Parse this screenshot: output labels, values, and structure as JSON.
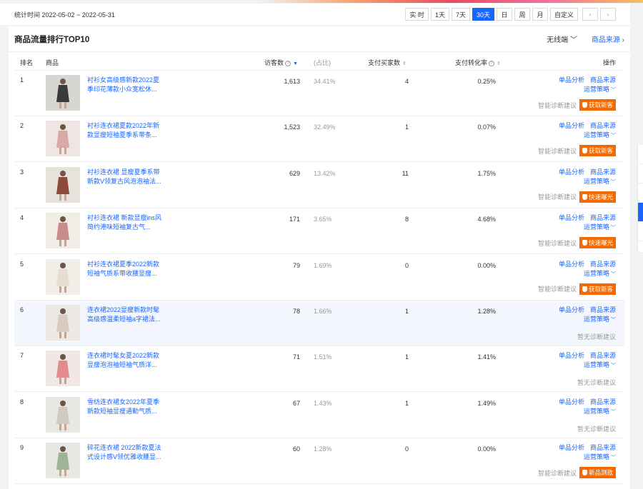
{
  "timebar": {
    "range": "统计时间 2022-05-02 ~ 2022-05-31",
    "buttons": [
      "实 时",
      "1天",
      "7天",
      "30天",
      "日",
      "周",
      "月",
      "自定义"
    ],
    "active": "30天"
  },
  "panel": {
    "title": "商品流量排行TOP10",
    "wireless": "无线端 ﹀",
    "source": "商品来源 ›"
  },
  "columns": {
    "rank": "排名",
    "product": "商品",
    "visits": "访客数",
    "ratio": "(占比)",
    "buyers": "支付买家数",
    "conv": "支付转化率",
    "ops": "操作"
  },
  "ops": {
    "analysis": "单品分析",
    "source": "商品来源",
    "strategy": "运营策略",
    "diag": "智能诊断建议",
    "nodiag": "暂无诊断建议"
  },
  "rows": [
    {
      "rank": "1",
      "title": "衬衫女高级感新款2022夏季印花薄款小众宽松休...",
      "visits": "1,613",
      "ratio": "34.41%",
      "buyers": "4",
      "conv": "0.25%",
      "tag": "获取新客"
    },
    {
      "rank": "2",
      "title": "衬衫连衣裙夏款2022年新款显瘦短袖夏季系带条...",
      "visits": "1,523",
      "ratio": "32.49%",
      "buyers": "1",
      "conv": "0.07%",
      "tag": "获取新客"
    },
    {
      "rank": "3",
      "title": "衬衫连衣裙 显瘦夏季系带新款V领复古风泡泡袖法...",
      "visits": "629",
      "ratio": "13.42%",
      "buyers": "11",
      "conv": "1.75%",
      "tag": "快速曝光"
    },
    {
      "rank": "4",
      "title": "衬衫连衣裙 新款显瘦ins风简约港味短袖复古气...",
      "visits": "171",
      "ratio": "3.65%",
      "buyers": "8",
      "conv": "4.68%",
      "tag": "快速曝光"
    },
    {
      "rank": "5",
      "title": "衬衫连衣裙夏季2022新款短袖气质系带收腰显瘦...",
      "visits": "79",
      "ratio": "1.69%",
      "buyers": "0",
      "conv": "0.00%",
      "tag": "获取新客"
    },
    {
      "rank": "6",
      "title": "连衣裙2022显瘦新款时髦高级感温柔短袖a字裙法...",
      "visits": "78",
      "ratio": "1.66%",
      "buyers": "1",
      "conv": "1.28%",
      "tag": ""
    },
    {
      "rank": "7",
      "title": "连衣裙时髦女夏2022新款显瘦泡泡袖短袖气质洋...",
      "visits": "71",
      "ratio": "1.51%",
      "buyers": "1",
      "conv": "1.41%",
      "tag": ""
    },
    {
      "rank": "8",
      "title": "雪纺连衣裙女2022年夏季新款短袖显瘦通勤气质...",
      "visits": "67",
      "ratio": "1.43%",
      "buyers": "1",
      "conv": "1.49%",
      "tag": ""
    },
    {
      "rank": "9",
      "title": "碎花连衣裙 2022新款夏法式设计感V领优雅收腰显...",
      "visits": "60",
      "ratio": "1.28%",
      "buyers": "0",
      "conv": "0.00%",
      "tag": "新品测款"
    }
  ],
  "colors": {
    "accent": "#1966ff",
    "tag": "#f56a00",
    "highlight_row": "#f3f6fc"
  }
}
